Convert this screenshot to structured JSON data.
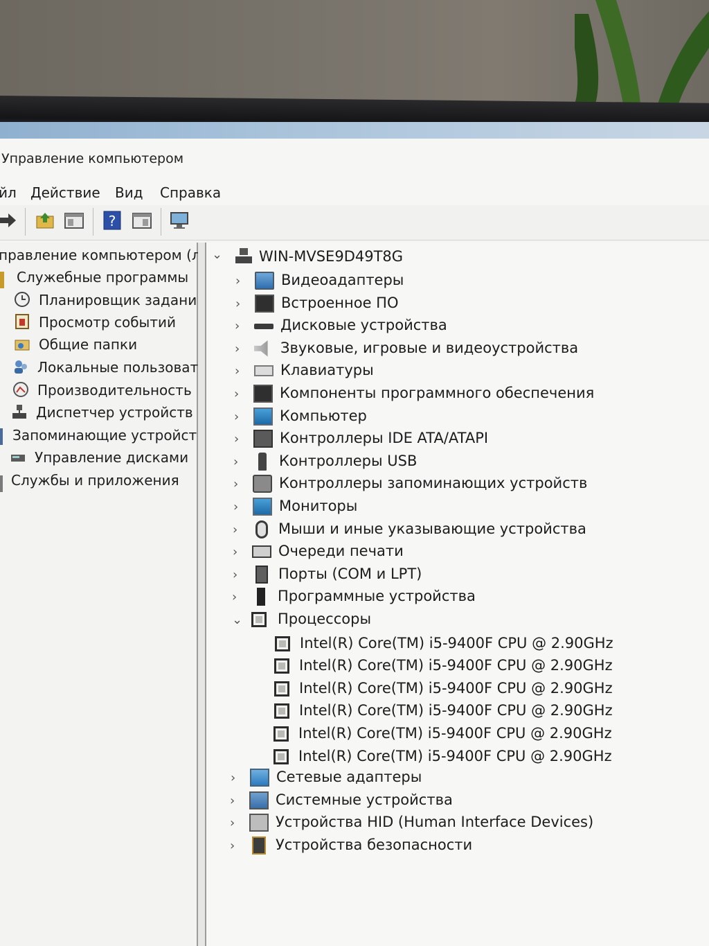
{
  "window": {
    "title": "Управление компьютером"
  },
  "menubar": {
    "items": [
      "йл",
      "Действие",
      "Вид",
      "Справка"
    ]
  },
  "left_tree": {
    "root": "правление компьютером (л",
    "items": [
      {
        "label": "Служебные программы",
        "icon": "tools-icon"
      },
      {
        "label": "Планировщик заданий",
        "icon": "clock-icon"
      },
      {
        "label": "Просмотр событий",
        "icon": "event-viewer-icon"
      },
      {
        "label": "Общие папки",
        "icon": "shared-folder-icon"
      },
      {
        "label": "Локальные пользовате",
        "icon": "users-icon"
      },
      {
        "label": "Производительность",
        "icon": "performance-icon"
      },
      {
        "label": "Диспетчер устройств",
        "icon": "device-manager-icon"
      },
      {
        "label": "Запоминающие устройст",
        "icon": "storage-icon"
      },
      {
        "label": "Управление дисками",
        "icon": "disk-management-icon"
      },
      {
        "label": "Службы и приложения",
        "icon": "services-icon"
      }
    ]
  },
  "device_tree": {
    "host": "WIN-MVSE9D49T8G",
    "categories": [
      {
        "label": "Видеоадаптеры",
        "icon": "display-adapter-icon",
        "expanded": false
      },
      {
        "label": "Встроенное ПО",
        "icon": "firmware-icon",
        "expanded": false
      },
      {
        "label": "Дисковые устройства",
        "icon": "disk-drive-icon",
        "expanded": false
      },
      {
        "label": "Звуковые, игровые и видеоустройства",
        "icon": "sound-icon",
        "expanded": false
      },
      {
        "label": "Клавиатуры",
        "icon": "keyboard-icon",
        "expanded": false
      },
      {
        "label": "Компоненты программного обеспечения",
        "icon": "software-component-icon",
        "expanded": false
      },
      {
        "label": "Компьютер",
        "icon": "computer-icon",
        "expanded": false
      },
      {
        "label": "Контроллеры IDE ATA/ATAPI",
        "icon": "ide-controller-icon",
        "expanded": false
      },
      {
        "label": "Контроллеры USB",
        "icon": "usb-icon",
        "expanded": false
      },
      {
        "label": "Контроллеры запоминающих устройств",
        "icon": "storage-controller-icon",
        "expanded": false
      },
      {
        "label": "Мониторы",
        "icon": "monitor-icon",
        "expanded": false
      },
      {
        "label": "Мыши и иные указывающие устройства",
        "icon": "mouse-icon",
        "expanded": false
      },
      {
        "label": "Очереди печати",
        "icon": "print-queue-icon",
        "expanded": false
      },
      {
        "label": "Порты (COM и LPT)",
        "icon": "port-icon",
        "expanded": false
      },
      {
        "label": "Программные устройства",
        "icon": "software-device-icon",
        "expanded": false
      },
      {
        "label": "Процессоры",
        "icon": "processor-icon",
        "expanded": true
      },
      {
        "label": "Сетевые адаптеры",
        "icon": "network-adapter-icon",
        "expanded": false
      },
      {
        "label": "Системные устройства",
        "icon": "system-device-icon",
        "expanded": false
      },
      {
        "label": "Устройства HID (Human Interface Devices)",
        "icon": "hid-icon",
        "expanded": false
      },
      {
        "label": "Устройства безопасности",
        "icon": "security-device-icon",
        "expanded": false
      }
    ],
    "processors": [
      "Intel(R) Core(TM) i5-9400F CPU @ 2.90GHz",
      "Intel(R) Core(TM) i5-9400F CPU @ 2.90GHz",
      "Intel(R) Core(TM) i5-9400F CPU @ 2.90GHz",
      "Intel(R) Core(TM) i5-9400F CPU @ 2.90GHz",
      "Intel(R) Core(TM) i5-9400F CPU @ 2.90GHz",
      "Intel(R) Core(TM) i5-9400F CPU @ 2.90GHz"
    ]
  }
}
